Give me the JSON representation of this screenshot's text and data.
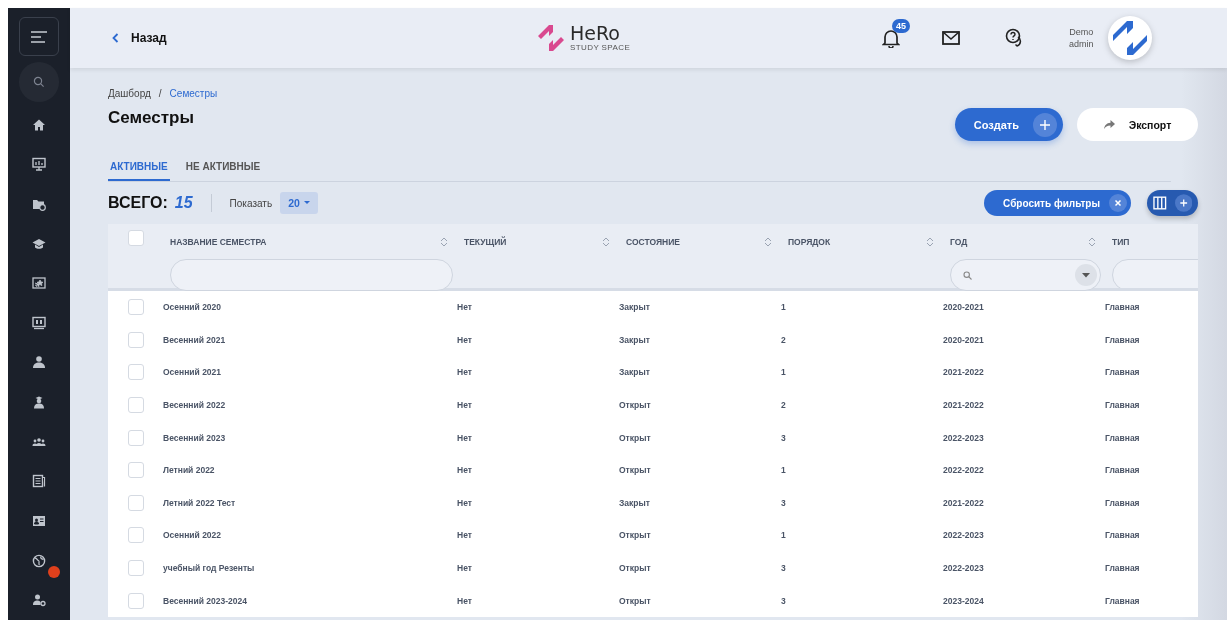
{
  "sidebar": {
    "items": [
      {
        "alert": false
      },
      {
        "alert": false
      },
      {
        "alert": false
      },
      {
        "alert": false
      },
      {
        "alert": false
      },
      {
        "alert": false
      },
      {
        "alert": false
      },
      {
        "alert": false
      },
      {
        "alert": false
      },
      {
        "alert": false
      },
      {
        "alert": false
      },
      {
        "alert": true
      },
      {
        "alert": false
      }
    ]
  },
  "header": {
    "back": "Назад",
    "logo_name": "HeRo",
    "logo_tagline": "STUDY SPACE",
    "notifications": "45",
    "user_name": "Demo",
    "user_role": "admin"
  },
  "breadcrumb": [
    {
      "label": "Дашборд",
      "selected": false
    },
    {
      "label": "Семестры",
      "selected": true
    }
  ],
  "breadcrumb_separator": "/",
  "title": "Семестры",
  "actions": {
    "create": "Создать",
    "export": "Экспорт"
  },
  "tabs": [
    {
      "label": "АКТИВНЫЕ",
      "selected": true
    },
    {
      "label": "НЕ АКТИВНЫЕ",
      "selected": false
    }
  ],
  "toolbar": {
    "total_label": "ВСЕГО:",
    "total": "15",
    "show_label": "Показать",
    "page_size": "20",
    "reset_filters": "Сбросить фильтры"
  },
  "table": {
    "all_checked": false,
    "columns": [
      {
        "label": "НАЗВАНИЕ СЕМЕСТРА",
        "kind": "text"
      },
      {
        "label": "ТЕКУЩИЙ",
        "kind": "plain"
      },
      {
        "label": "СОСТОЯНИЕ",
        "kind": "plain"
      },
      {
        "label": "ПОРЯДОК",
        "kind": "plain"
      },
      {
        "label": "ГОД",
        "kind": "select"
      },
      {
        "label": "ТИП",
        "kind": "text"
      }
    ],
    "rows": [
      {
        "checked": false,
        "cells": [
          "Осенний 2020",
          "Нет",
          "Закрыт",
          "1",
          "2020-2021",
          "Главная"
        ]
      },
      {
        "checked": false,
        "cells": [
          "Весенний 2021",
          "Нет",
          "Закрыт",
          "2",
          "2020-2021",
          "Главная"
        ]
      },
      {
        "checked": false,
        "cells": [
          "Осенний 2021",
          "Нет",
          "Закрыт",
          "1",
          "2021-2022",
          "Главная"
        ]
      },
      {
        "checked": false,
        "cells": [
          "Весенний 2022",
          "Нет",
          "Открыт",
          "2",
          "2021-2022",
          "Главная"
        ]
      },
      {
        "checked": false,
        "cells": [
          "Весенний 2023",
          "Нет",
          "Открыт",
          "3",
          "2022-2023",
          "Главная"
        ]
      },
      {
        "checked": false,
        "cells": [
          "Летний 2022",
          "Нет",
          "Открыт",
          "1",
          "2022-2022",
          "Главная"
        ]
      },
      {
        "checked": false,
        "cells": [
          "Летний 2022 Тест",
          "Нет",
          "Закрыт",
          "3",
          "2021-2022",
          "Главная"
        ]
      },
      {
        "checked": false,
        "cells": [
          "Осенний 2022",
          "Нет",
          "Открыт",
          "1",
          "2022-2023",
          "Главная"
        ]
      },
      {
        "checked": false,
        "cells": [
          "учебный год Резенты",
          "Нет",
          "Открыт",
          "3",
          "2022-2023",
          "Главная"
        ]
      },
      {
        "checked": false,
        "cells": [
          "Весенний 2023-2024",
          "Нет",
          "Открыт",
          "3",
          "2023-2024",
          "Главная"
        ]
      }
    ]
  }
}
